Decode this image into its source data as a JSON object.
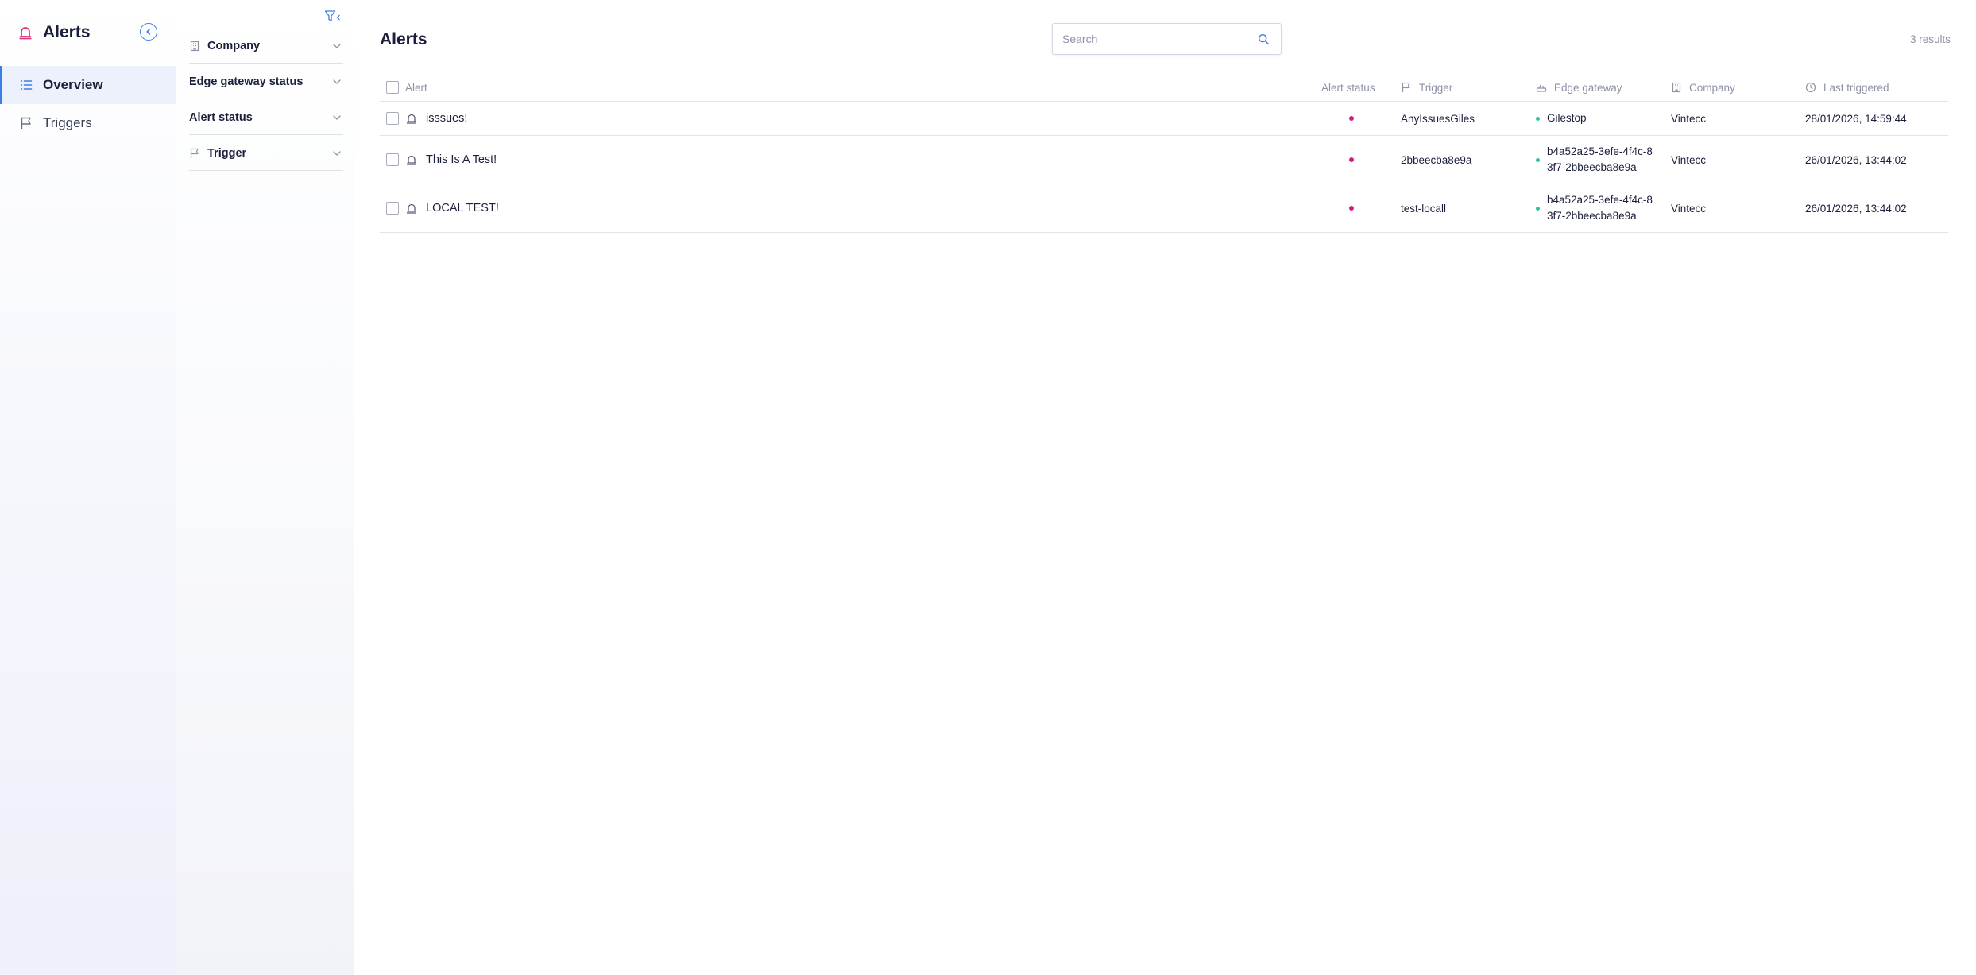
{
  "brand": {
    "title": "Alerts"
  },
  "nav": {
    "items": [
      {
        "label": "Overview",
        "icon": "list-icon",
        "active": true
      },
      {
        "label": "Triggers",
        "icon": "flag-icon",
        "active": false
      }
    ]
  },
  "filters": {
    "items": [
      {
        "label": "Company",
        "icon": "building-icon"
      },
      {
        "label": "Edge gateway status",
        "icon": ""
      },
      {
        "label": "Alert status",
        "icon": ""
      },
      {
        "label": "Trigger",
        "icon": "flag-icon"
      }
    ]
  },
  "main": {
    "title": "Alerts",
    "search_placeholder": "Search",
    "results": "3 results"
  },
  "table": {
    "headers": {
      "alert": "Alert",
      "alert_status": "Alert status",
      "trigger": "Trigger",
      "edge_gateway": "Edge gateway",
      "company": "Company",
      "last_triggered": "Last triggered"
    },
    "rows": [
      {
        "alert": "isssues!",
        "trigger": "AnyIssuesGiles",
        "edge_gateway": "Gilestop",
        "company": "Vintecc",
        "last_triggered": "28/01/2026, 14:59:44"
      },
      {
        "alert": "This Is A Test!",
        "trigger": "2bbeecba8e9a",
        "edge_gateway": "b4a52a25-3efe-4f4c-83f7-2bbeecba8e9a",
        "company": "Vintecc",
        "last_triggered": "26/01/2026, 13:44:02"
      },
      {
        "alert": "LOCAL TEST!",
        "trigger": "test-locall",
        "edge_gateway": "b4a52a25-3efe-4f4c-83f7-2bbeecba8e9a",
        "company": "Vintecc",
        "last_triggered": "26/01/2026, 13:44:02"
      }
    ]
  },
  "colors": {
    "accent": "#3c7ce6",
    "brand": "#e0307e",
    "status_alert": "#d61a7e",
    "gateway_online": "#2bc59a"
  }
}
